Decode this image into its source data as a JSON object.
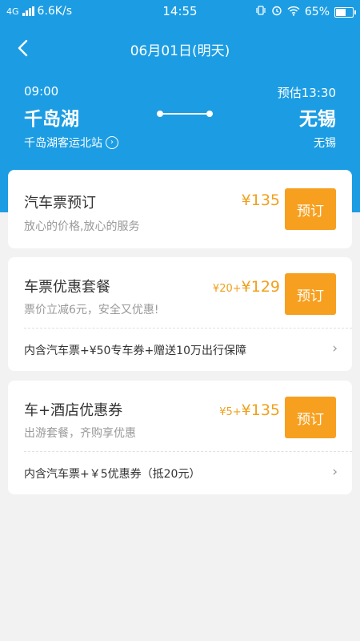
{
  "status_bar": {
    "network": "4G",
    "speed": "6.6K/s",
    "time": "14:55",
    "battery": "65%",
    "battery_level": 0.65
  },
  "nav": {
    "title": "06月01日(明天)"
  },
  "route": {
    "depart_time": "09:00",
    "arrive_time": "预估13:30",
    "from_city": "千岛湖",
    "to_city": "无锡",
    "from_station": "千岛湖客运北站",
    "to_station": "无锡"
  },
  "cards": [
    {
      "title": "汽车票预订",
      "subtitle": "放心的价格,放心的服务",
      "price_extra": "",
      "price": "¥135",
      "button": "预订"
    },
    {
      "title": "车票优惠套餐",
      "subtitle": "票价立减6元，安全又优惠!",
      "price_extra": "¥20+",
      "price": "¥129",
      "button": "预订",
      "detail": "内含汽车票+¥50专车券+赠送10万出行保障"
    },
    {
      "title": "车+酒店优惠券",
      "subtitle": "出游套餐，齐购享优惠",
      "price_extra": "¥5+",
      "price": "¥135",
      "button": "预订",
      "detail": "内含汽车票+￥5优惠券（抵20元）"
    }
  ],
  "colors": {
    "header_blue": "#1c9de3",
    "accent_orange": "#f7a020",
    "price_orange": "#f0a01b"
  }
}
